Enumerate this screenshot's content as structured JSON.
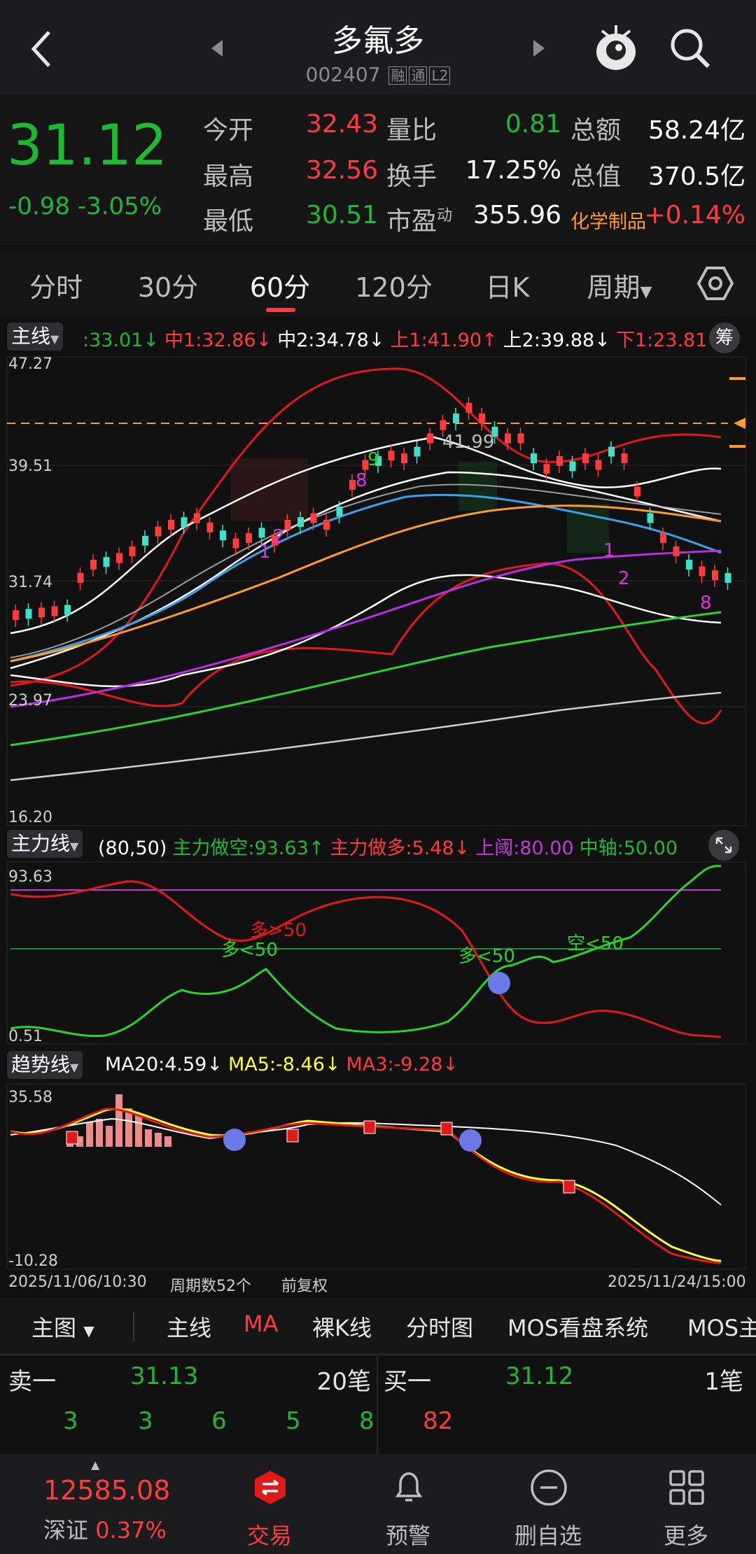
{
  "header": {
    "stock_name": "多氟多",
    "stock_code": "002407",
    "tags": [
      "融",
      "通",
      "L2"
    ]
  },
  "quote": {
    "price": "31.12",
    "change": "-0.98",
    "change_pct": "-3.05%",
    "fields": {
      "open_label": "今开",
      "open": "32.43",
      "high_label": "最高",
      "high": "32.56",
      "low_label": "最低",
      "low": "30.51",
      "vol_ratio_label": "量比",
      "vol_ratio": "0.81",
      "turnover_label": "换手",
      "turnover": "17.25%",
      "pe_label": "市盈",
      "pe_sup": "动",
      "pe": "355.96",
      "amount_label": "总额",
      "amount": "58.24亿",
      "mktcap_label": "总值",
      "mktcap": "370.5亿",
      "sector_label": "化学制品",
      "sector_change": "+0.14%"
    }
  },
  "period_tabs": [
    "分时",
    "30分",
    "60分",
    "120分",
    "日K",
    "周期"
  ],
  "active_tab": "60分",
  "main_chart": {
    "selector": "主线",
    "indicators": [
      {
        "text": ":33.01",
        "color": "#1db934",
        "arrow": "↓"
      },
      {
        "text": "中1:32.86",
        "color": "#ff3b3b",
        "arrow": "↓"
      },
      {
        "text": "中2:34.78",
        "color": "#ffffff",
        "arrow": "↓"
      },
      {
        "text": "上1:41.90",
        "color": "#ff3b3b",
        "arrow": "↑"
      },
      {
        "text": "上2:39.88",
        "color": "#ffffff",
        "arrow": "↓"
      },
      {
        "text": "下1:23.81",
        "color": "#ff3b3b",
        "arrow": "↓"
      }
    ],
    "chip_button": "筹",
    "y_labels": [
      "47.27",
      "39.51",
      "31.74",
      "23.97",
      "16.20"
    ],
    "peak_label": "41.99",
    "signal_labels": [
      "1",
      "2",
      "8",
      "9",
      "1",
      "2",
      "8"
    ]
  },
  "sub1": {
    "selector": "主力线",
    "params": "(80,50)",
    "items": [
      {
        "text": "主力做空:93.63",
        "color": "#1db934",
        "arrow": "↑"
      },
      {
        "text": "主力做多:5.48",
        "color": "#ff3b3b",
        "arrow": "↓"
      },
      {
        "text": "上阈:80.00",
        "color": "#c03ad8",
        "arrow": ""
      },
      {
        "text": "中轴:50.00",
        "color": "#1db934",
        "arrow": ""
      }
    ],
    "y_labels": [
      "93.63",
      "0.51"
    ],
    "annotations": [
      "多>50",
      "多<50",
      "多<50",
      "空<50"
    ]
  },
  "sub2": {
    "selector": "趋势线",
    "items": [
      {
        "text": "MA20:4.59",
        "color": "#ffffff",
        "arrow": "↓"
      },
      {
        "text": "MA5:-8.46",
        "color": "#ffff3a",
        "arrow": "↓"
      },
      {
        "text": "MA3:-9.28",
        "color": "#ff3b3b",
        "arrow": "↓"
      }
    ],
    "y_labels": [
      "35.58",
      "-10.28"
    ]
  },
  "footer": {
    "start_time": "2025/11/06/10:30",
    "period_count": "周期数52个",
    "adjust": "前复权",
    "end_time": "2025/11/24/15:00"
  },
  "main_menu": {
    "selector": "主图",
    "items": [
      "主线",
      "MA",
      "裸K线",
      "分时图",
      "MOS看盘系统",
      "MOS主"
    ],
    "active": "MA"
  },
  "orderbook": {
    "sell_label": "卖一",
    "sell_price": "31.13",
    "sell_count": "20笔",
    "buy_label": "买一",
    "buy_price": "31.12",
    "buy_count": "1笔",
    "sell_queue": [
      "3",
      "3",
      "6",
      "5",
      "8"
    ],
    "buy_queue": [
      "82"
    ]
  },
  "bottom_nav": {
    "index_value": "12585.08",
    "index_name": "深证",
    "index_change": "0.37%",
    "items": [
      "交易",
      "预警",
      "删自选",
      "更多"
    ]
  },
  "colors": {
    "up": "#ff3b3b",
    "down": "#1db934",
    "accent": "#ff3b3b"
  }
}
